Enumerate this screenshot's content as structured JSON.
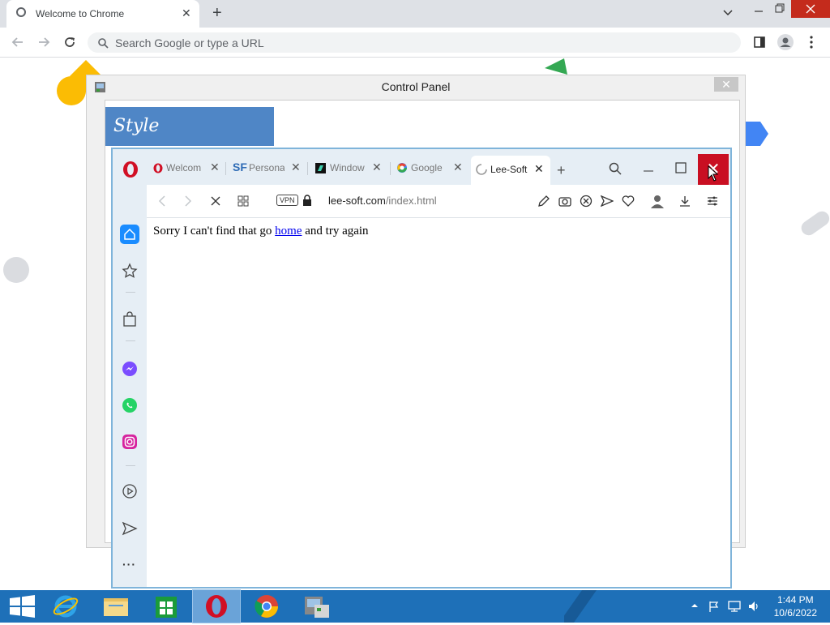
{
  "chrome": {
    "tab_title": "Welcome to Chrome",
    "tab_close": "✕",
    "new_tab": "+",
    "omnibox_placeholder": "Search Google or type a URL",
    "icons": [
      "globe-icon",
      "back-icon",
      "forward-icon",
      "reload-icon",
      "search-icon",
      "sidepanel-icon",
      "profile-icon",
      "menu-icon"
    ]
  },
  "control_panel": {
    "title": "Control Panel",
    "close": "✕",
    "style_label": "Style"
  },
  "opera": {
    "tabs": [
      {
        "label": "Welcom",
        "icon": "opera-icon",
        "icon_color": "#d10f24"
      },
      {
        "label": "Personal",
        "icon": "sf-icon",
        "icon_text": "SF",
        "icon_color": "#2e6bb5"
      },
      {
        "label": "Window",
        "icon": "app-icon",
        "icon_color": "#111"
      },
      {
        "label": "Google",
        "icon": "google-icon",
        "icon_color": "#4285f4"
      },
      {
        "label": "Lee-Soft",
        "icon": "loading-icon",
        "icon_color": "#999",
        "active": true
      }
    ],
    "url_host": "lee-soft.com",
    "url_path": "/index.html",
    "vpn_label": "VPN",
    "page_message_before": "Sorry I can't find that go",
    "page_link": "home",
    "page_message_after": "and try again",
    "sidebar_more": "···"
  },
  "taskbar": {
    "time": "1:44 PM",
    "date": "10/6/2022",
    "accent": "#1e70b8"
  }
}
